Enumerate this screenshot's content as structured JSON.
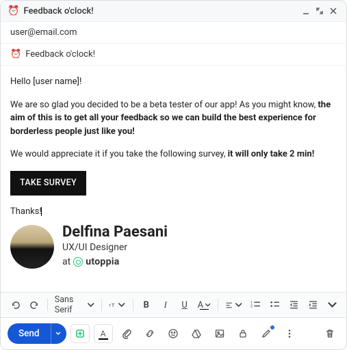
{
  "header": {
    "emoji": "⏰",
    "title": "Feedback o'clock!"
  },
  "to": "user@email.com",
  "subject_emoji": "⏰",
  "subject": "Feedback o'clock!",
  "body": {
    "greeting": "Hello [user name]!",
    "p1_a": "We are so glad you decided to be a beta tester of our app! As you might know, ",
    "p1_b": "the aim of this is to get all your feedback so we can build the best experience for borderless people just like you!",
    "p2_a": "We would appreciate it if you take the following survey, ",
    "p2_b": "it will only take 2 min!",
    "button": "TAKE SURVEY",
    "thanks": "Thanks!"
  },
  "signature": {
    "name": "Delfina Paesani",
    "role": "UX/UI Designer",
    "at": "at",
    "company": "utoppia"
  },
  "toolbar": {
    "font": "Sans Serif"
  },
  "bottom": {
    "send": "Send"
  }
}
